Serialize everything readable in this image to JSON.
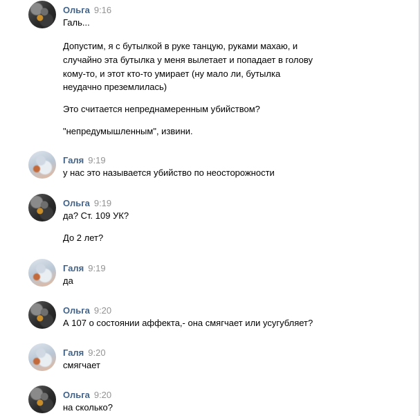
{
  "messages": [
    {
      "author": "Ольга",
      "time": "9:16",
      "avatar": "olga-avatar",
      "lines": [
        "Галь...",
        "Допустим, я с бутылкой в руке танцую, руками махаю, и",
        "случайно эта бутылка у меня вылетает и попадает в голову",
        "кому-то, и этот кто-то умирает (ну мало ли, бутылка",
        "неудачно преземлилась)",
        "Это считается непреднамеренным убийством?",
        "\"непредумышленным\", извини."
      ]
    },
    {
      "author": "Галя",
      "time": "9:19",
      "avatar": "galya-avatar",
      "lines": [
        "у нас это называется убийство по неосторожности"
      ]
    },
    {
      "author": "Ольга",
      "time": "9:19",
      "avatar": "olga-avatar",
      "lines": [
        "да? Ст. 109 УК?",
        "До 2 лет?"
      ]
    },
    {
      "author": "Галя",
      "time": "9:19",
      "avatar": "galya-avatar",
      "lines": [
        "да"
      ]
    },
    {
      "author": "Ольга",
      "time": "9:20",
      "avatar": "olga-avatar",
      "lines": [
        "А 107 о состоянии аффекта,- она смягчает или усугубляет?"
      ]
    },
    {
      "author": "Галя",
      "time": "9:20",
      "avatar": "galya-avatar",
      "lines": [
        "смягчает"
      ]
    },
    {
      "author": "Ольга",
      "time": "9:20",
      "avatar": "olga-avatar",
      "lines": [
        "на сколько?"
      ]
    }
  ],
  "colors": {
    "author": "#42648b",
    "time": "#939393",
    "text": "#000000"
  }
}
